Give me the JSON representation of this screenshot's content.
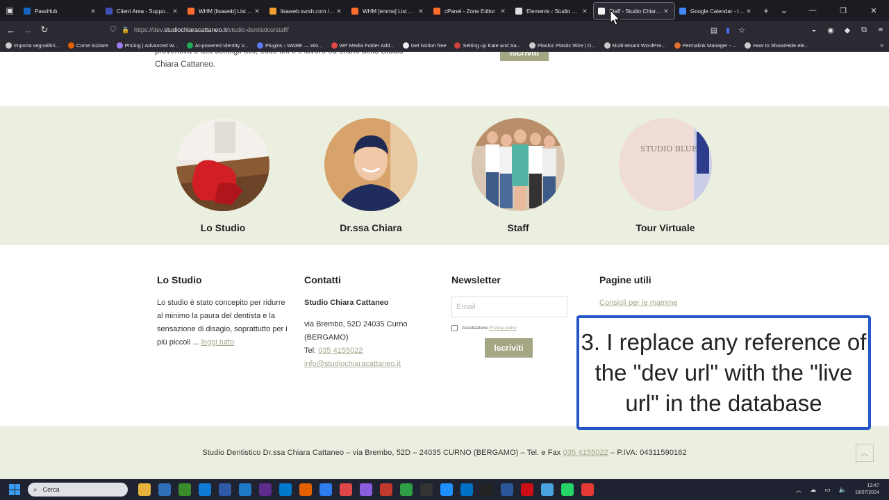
{
  "browser": {
    "tabs": [
      {
        "label": "PassHub",
        "color": "#1565c0",
        "active": false
      },
      {
        "label": "Client Area - SupportH",
        "color": "#3f51b5",
        "active": false
      },
      {
        "label": "WHM [lisaweb] List Acc",
        "color": "#ff6c2c",
        "active": false
      },
      {
        "label": "lisaweb.svrsh.com / lo",
        "color": "#f0a030",
        "active": false
      },
      {
        "label": "WHM [emma] List Acc",
        "color": "#ff6c2c",
        "active": false
      },
      {
        "label": "cPanel - Zone Editor",
        "color": "#ff6c2c",
        "active": false
      },
      {
        "label": "Elements ‹ Studio Chia",
        "color": "#dddddd",
        "active": false
      },
      {
        "label": "Staff - Studio Chiara C",
        "color": "#f5f5f5",
        "active": true
      },
      {
        "label": "Google Calendar - lugl",
        "color": "#4285f4",
        "active": false
      }
    ],
    "url_prefix": "https://dev.",
    "url_domain": "studiochiaracattaneo.it",
    "url_path": "/studio-dentistico/staff/",
    "bookmarks": [
      {
        "label": "Importa segnalibri...",
        "color": "#cccccc"
      },
      {
        "label": "Come iniziare",
        "color": "#e66000"
      },
      {
        "label": "Pricing | Advanced W...",
        "color": "#9c7cf0"
      },
      {
        "label": "AI-powered Identity V...",
        "color": "#22aa55"
      },
      {
        "label": "Plugins ‹ WARE — Wo...",
        "color": "#5b7cf0"
      },
      {
        "label": "WP Media Folder Add...",
        "color": "#e04848"
      },
      {
        "label": "Get Notion free",
        "color": "#eeeeee"
      },
      {
        "label": "Setting up Kate and Sa...",
        "color": "#d04040"
      },
      {
        "label": "Plasloc Plastic Wire | D...",
        "color": "#cccccc"
      },
      {
        "label": "Multi-tenant WordPre...",
        "color": "#cccccc"
      },
      {
        "label": "Permalink Manager - ...",
        "color": "#e07030"
      },
      {
        "label": "How to Show/Hide ele...",
        "color": "#cccccc"
      }
    ]
  },
  "page": {
    "top_text": "preventiva e utili consigli utili, ecco chi è il lavoro ed orario dello Studio Chiara Cattaneo.",
    "top_button": "Iscriviti",
    "circles": [
      {
        "caption": "Lo Studio"
      },
      {
        "caption": "Dr.ssa Chiara"
      },
      {
        "caption": "Staff"
      },
      {
        "caption": "Tour Virtuale",
        "sign": "STUDIO BLUE"
      }
    ],
    "footer_cols": {
      "studio": {
        "title": "Lo Studio",
        "text": "Lo studio è stato concepito per ridurre al minimo la paura del dentista e la sensazione di disagio, soprattutto per i più piccoli ...",
        "link": "leggi tutto"
      },
      "contatti": {
        "title": "Contatti",
        "name": "Studio Chiara Cattaneo",
        "address": "via Brembo, 52D 24035 Curno (BERGAMO)",
        "tel_label": "Tel:",
        "tel": "035 4155022",
        "email": "info@studiochiaracattaneo.it"
      },
      "newsletter": {
        "title": "Newsletter",
        "email_placeholder": "Email",
        "consent": "Accettazione",
        "privacy": "Privacy policy",
        "button": "Iscriviti"
      },
      "pagine": {
        "title": "Pagine utili",
        "link": "Consigli per le mamme"
      }
    },
    "footer_bar": {
      "text": "Studio Dentistico Dr.ssa Chiara Cattaneo – via Brembo, 52D – 24035 CURNO (BERGAMO) – Tel. e Fax",
      "phone": "035 4155022",
      "piva": "– P.IVA: 04311590162"
    },
    "overlay": "3. I replace any reference of the \"dev url\" with the \"live url\" in the database"
  },
  "taskbar": {
    "search": "Cerca",
    "time": "13:47",
    "date": "18/07/2024",
    "icons": [
      "#e8b33c",
      "#2d6fb8",
      "#3b8c2a",
      "#0f7bd6",
      "#2f5aa8",
      "#1e7ac7",
      "#5d2c8c",
      "#007acc",
      "#e66000",
      "#2d7cf0",
      "#e04848",
      "#8a5ce0",
      "#c0392b",
      "#2e9e44",
      "#333333",
      "#1e90ff",
      "#0072c6",
      "#222222",
      "#2b579a",
      "#cc0f16",
      "#4aa3df",
      "#25d366",
      "#e53935"
    ]
  }
}
